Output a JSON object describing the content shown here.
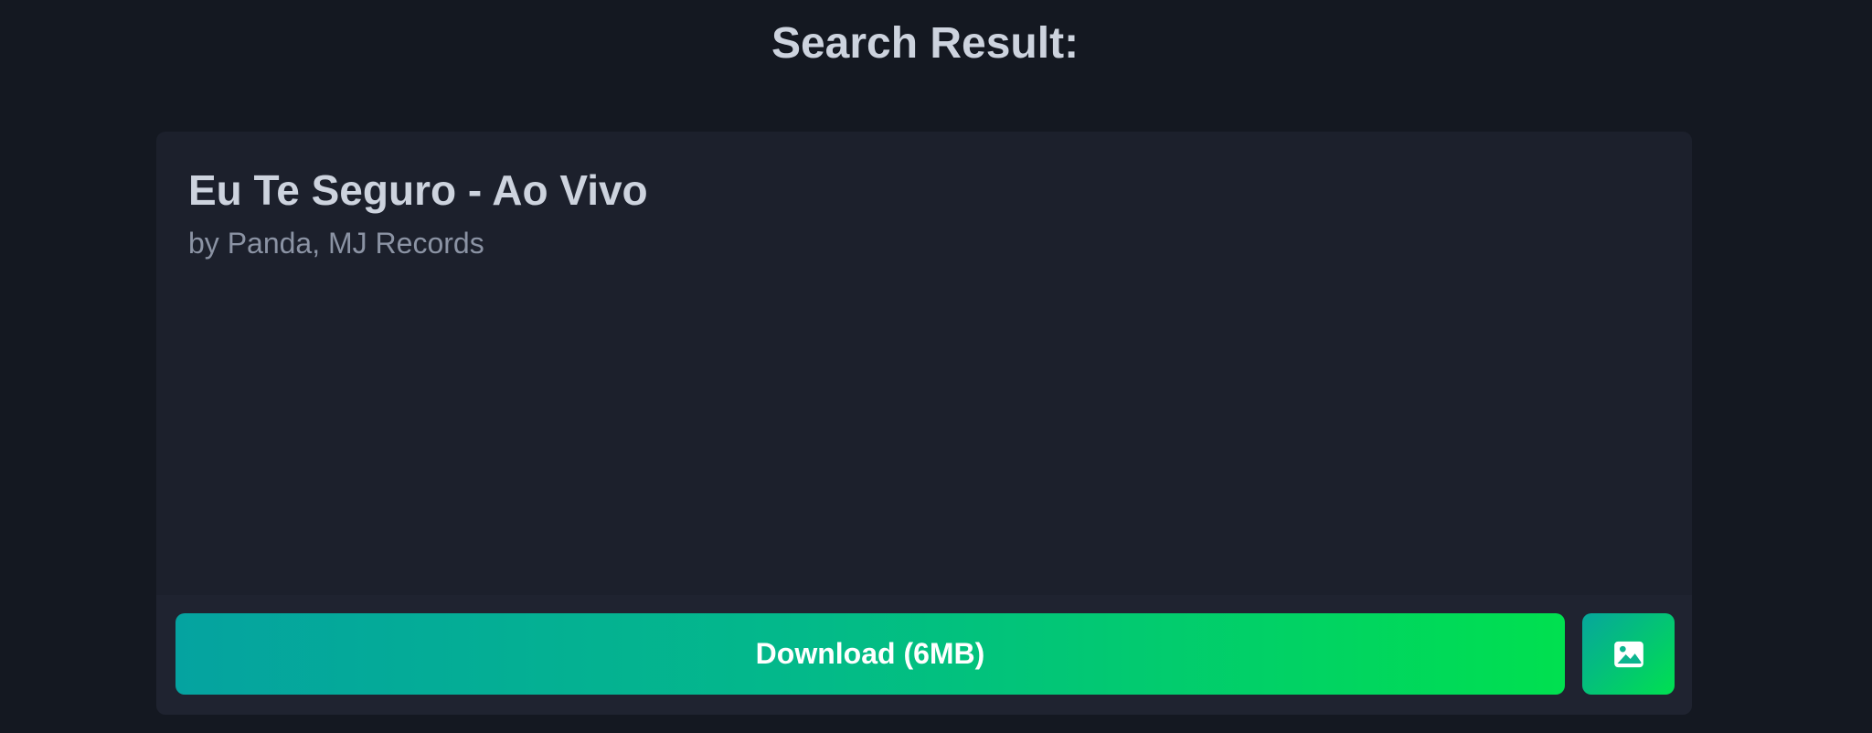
{
  "header": {
    "title": "Search Result:"
  },
  "result": {
    "title": "Eu Te Seguro - Ao Vivo",
    "artist": "by Panda, MJ Records",
    "download_label": "Download (6MB)",
    "image_button_icon": "image-icon"
  },
  "colors": {
    "background": "#141821",
    "card": "#1c202c",
    "accent_start": "#05a3a0",
    "accent_end": "#00e04f"
  }
}
